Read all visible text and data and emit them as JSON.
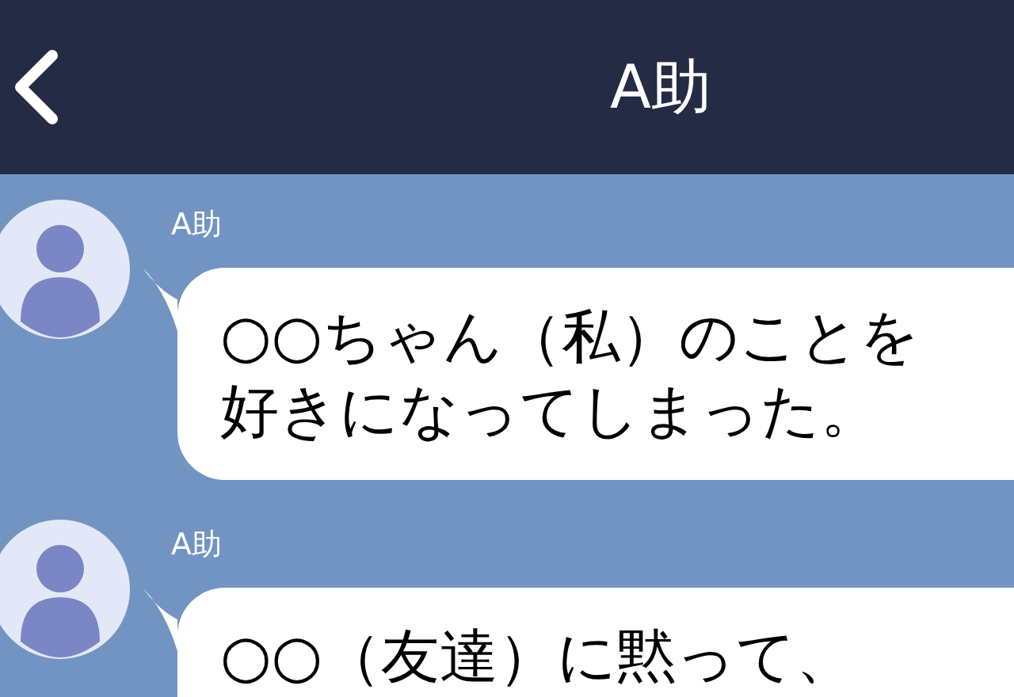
{
  "header": {
    "title": "A助"
  },
  "messages": [
    {
      "sender": "A助",
      "lines": [
        "○○ちゃん（私）のことを",
        "好きになってしまった。"
      ]
    },
    {
      "sender": "A助",
      "lines": [
        "○○（友達）に黙って、"
      ]
    }
  ]
}
